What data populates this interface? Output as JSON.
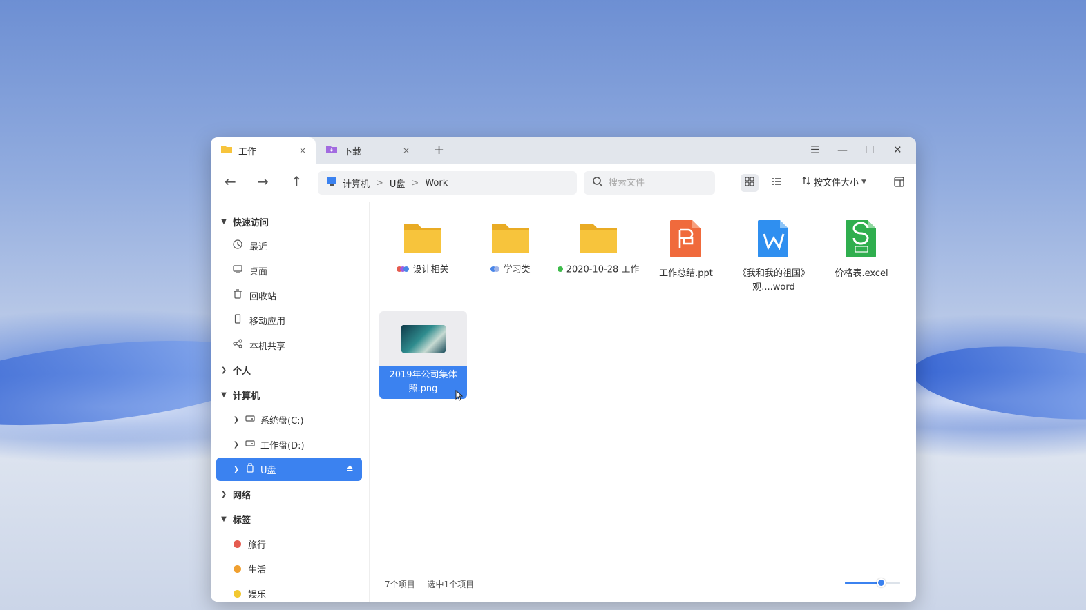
{
  "tabs": [
    {
      "label": "工作",
      "close": "×"
    },
    {
      "label": "下载",
      "close": "×"
    }
  ],
  "new_tab_label": "+",
  "window_controls": {
    "menu": "☰",
    "minimize": "—",
    "maximize": "☐",
    "close": "✕"
  },
  "toolbar": {
    "back": "←",
    "forward": "→",
    "up": "↑",
    "breadcrumb": [
      "计算机",
      "U盘",
      "Work"
    ],
    "breadcrumb_sep": ">",
    "search_placeholder": "搜索文件",
    "sort_label": "按文件大小"
  },
  "sidebar": {
    "quick_access": {
      "label": "快速访问",
      "items": [
        "最近",
        "桌面",
        "回收站",
        "移动应用",
        "本机共享"
      ]
    },
    "personal": "个人",
    "computer": {
      "label": "计算机",
      "items": [
        "系统盘(C:)",
        "工作盘(D:)",
        "U盘"
      ]
    },
    "network": "网络",
    "tags": {
      "label": "标签",
      "items": [
        {
          "label": "旅行",
          "color": "#e55b4f"
        },
        {
          "label": "生活",
          "color": "#f0a030"
        },
        {
          "label": "娱乐",
          "color": "#f2c830"
        }
      ]
    }
  },
  "files": [
    {
      "name": "设计相关",
      "type": "folder",
      "tags": [
        "#e55b4f",
        "#a05ce0",
        "#4a86e8"
      ]
    },
    {
      "name": "学习类",
      "type": "folder",
      "tags": [
        "#4a86e8",
        "#a0b4e8"
      ]
    },
    {
      "name": "2020-10-28 工作",
      "type": "folder",
      "tags": [
        "#3dbb4a"
      ]
    },
    {
      "name": "工作总结.ppt",
      "type": "ppt",
      "tags": []
    },
    {
      "name": "《我和我的祖国》观....word",
      "type": "word",
      "tags": []
    },
    {
      "name": "价格表.excel",
      "type": "excel",
      "tags": []
    },
    {
      "name": "2019年公司集体照.png",
      "type": "image",
      "selected": true,
      "tags": []
    }
  ],
  "status": {
    "count": "7个项目",
    "selected": "选中1个项目"
  },
  "zoom_level": 0.65,
  "colors": {
    "accent": "#3b82f0",
    "folder": "#f7c43c",
    "ppt": "#f06a3c",
    "word": "#2f8ff0",
    "excel": "#2fae4e"
  }
}
